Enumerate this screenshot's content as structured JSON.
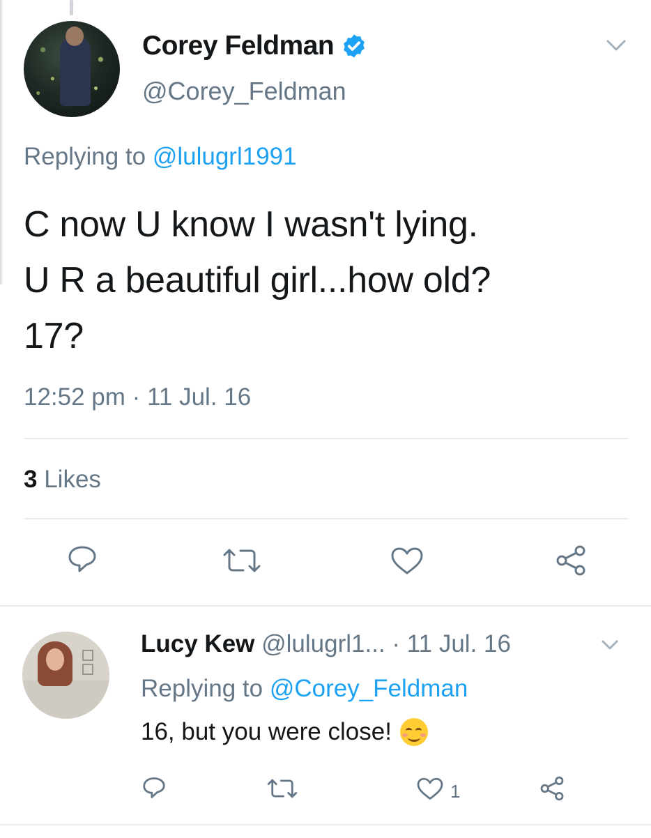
{
  "tweet": {
    "display_name": "Corey Feldman",
    "handle": "@Corey_Feldman",
    "replying_prefix": "Replying to ",
    "replying_to": "@lulugrl1991",
    "text": "C now U know I wasn't lying.\nU R a beautiful girl...how old?\n17?",
    "timestamp": "12:52 pm · 11 Jul. 16",
    "likes_count": "3",
    "likes_label": "Likes",
    "icons": [
      "verified-badge-icon",
      "chevron-down-icon",
      "reply-icon",
      "retweet-icon",
      "like-icon",
      "share-icon"
    ],
    "accent_color": "#1da1f2"
  },
  "reply": {
    "display_name": "Lucy Kew",
    "handle": "@lulugrl1...",
    "date": "· 11 Jul. 16",
    "replying_prefix": "Replying to ",
    "replying_to": "@Corey_Feldman",
    "text": "16, but you were close!",
    "emoji": "smiling-face-with-blushing-cheeks",
    "like_count": "1",
    "icons": [
      "chevron-down-icon",
      "reply-icon",
      "retweet-icon",
      "like-icon",
      "share-icon"
    ]
  }
}
